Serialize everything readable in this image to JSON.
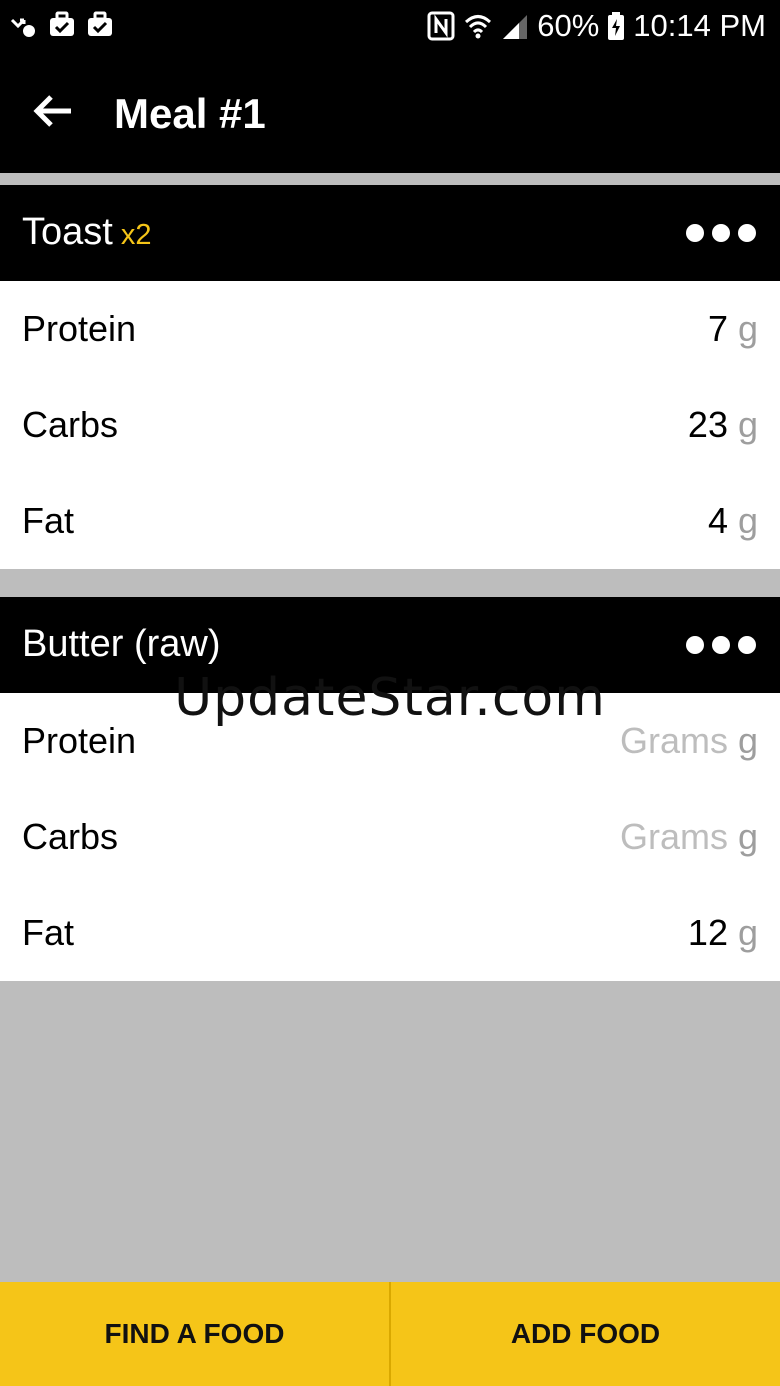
{
  "status_bar": {
    "battery": "60%",
    "time": "10:14 PM",
    "icons": [
      "missed-call-icon",
      "briefcase-icon",
      "briefcase-icon",
      "nfc-icon",
      "wifi-icon",
      "signal-icon",
      "battery-charging-icon"
    ]
  },
  "app_bar": {
    "title": "Meal #1",
    "back_icon": "arrow-left-icon"
  },
  "foods": [
    {
      "name": "Toast",
      "quantity": "x2",
      "rows": [
        {
          "label": "Protein",
          "value": "7",
          "placeholder": "Grams",
          "unit": "g"
        },
        {
          "label": "Carbs",
          "value": "23",
          "placeholder": "Grams",
          "unit": "g"
        },
        {
          "label": "Fat",
          "value": "4",
          "placeholder": "Grams",
          "unit": "g"
        }
      ]
    },
    {
      "name": "Butter (raw)",
      "quantity": "",
      "rows": [
        {
          "label": "Protein",
          "value": "",
          "placeholder": "Grams",
          "unit": "g"
        },
        {
          "label": "Carbs",
          "value": "",
          "placeholder": "Grams",
          "unit": "g"
        },
        {
          "label": "Fat",
          "value": "12",
          "placeholder": "Grams",
          "unit": "g"
        }
      ]
    }
  ],
  "watermark": "UpdateStar.com",
  "bottom_bar": {
    "find_label": "FIND A FOOD",
    "add_label": "ADD FOOD"
  },
  "colors": {
    "accent": "#f5c518",
    "header_bg": "#000000",
    "page_bg": "#bdbdbd"
  }
}
